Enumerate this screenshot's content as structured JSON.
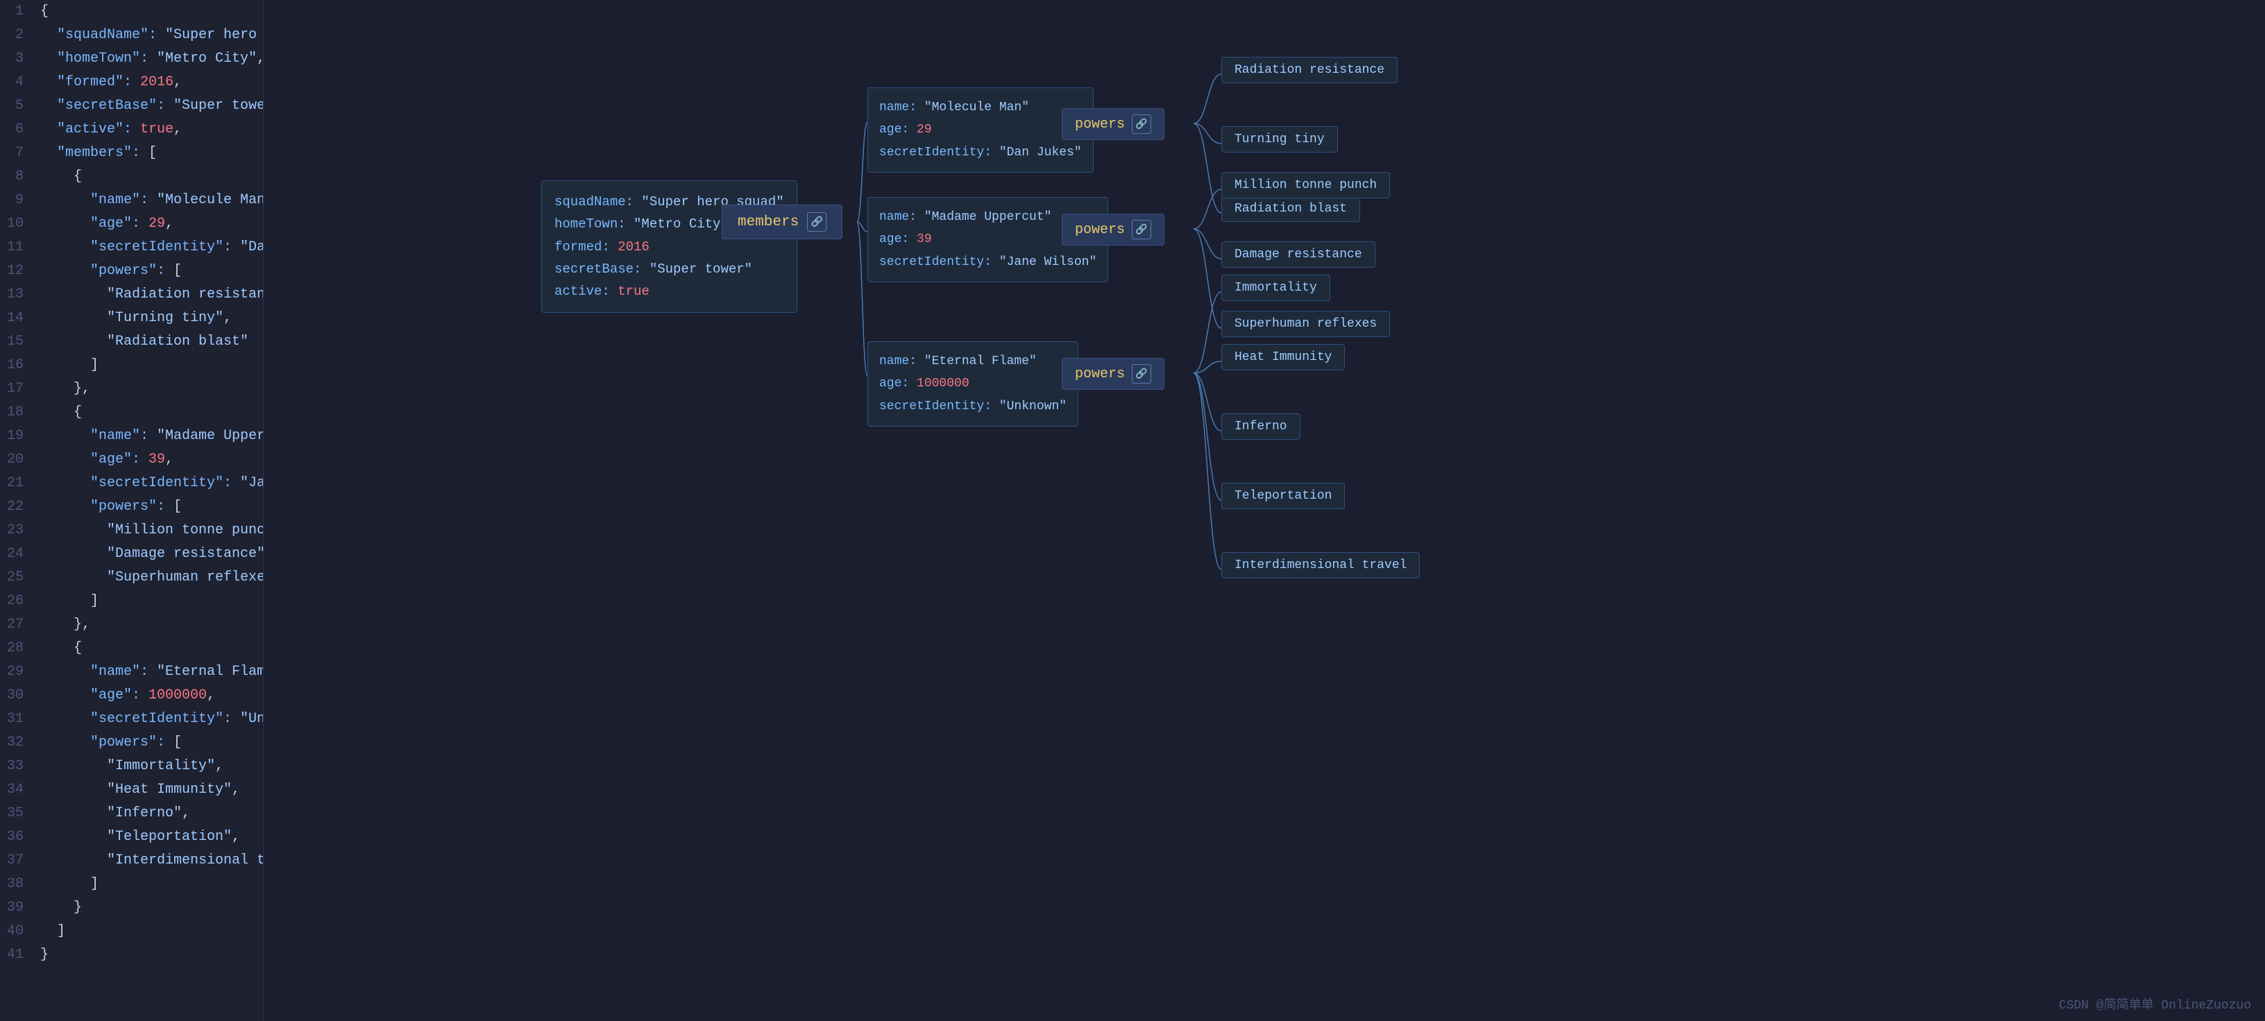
{
  "codeLines": [
    {
      "num": 1,
      "tokens": [
        {
          "t": "brace",
          "v": "{"
        }
      ]
    },
    {
      "num": 2,
      "tokens": [
        {
          "t": "key",
          "v": "  \"squadName\": "
        },
        {
          "t": "str",
          "v": "\"Super hero squad\""
        },
        {
          "t": "punct",
          "v": ","
        }
      ]
    },
    {
      "num": 3,
      "tokens": [
        {
          "t": "key",
          "v": "  \"homeTown\": "
        },
        {
          "t": "str",
          "v": "\"Metro City\""
        },
        {
          "t": "punct",
          "v": ","
        }
      ]
    },
    {
      "num": 4,
      "tokens": [
        {
          "t": "key",
          "v": "  \"formed\": "
        },
        {
          "t": "num",
          "v": "2016"
        },
        {
          "t": "punct",
          "v": ","
        }
      ]
    },
    {
      "num": 5,
      "tokens": [
        {
          "t": "key",
          "v": "  \"secretBase\": "
        },
        {
          "t": "str",
          "v": "\"Super tower\""
        },
        {
          "t": "punct",
          "v": ","
        }
      ]
    },
    {
      "num": 6,
      "tokens": [
        {
          "t": "key",
          "v": "  \"active\": "
        },
        {
          "t": "bool",
          "v": "true"
        },
        {
          "t": "punct",
          "v": ","
        }
      ]
    },
    {
      "num": 7,
      "tokens": [
        {
          "t": "key",
          "v": "  \"members\": "
        },
        {
          "t": "bracket",
          "v": "["
        }
      ]
    },
    {
      "num": 8,
      "tokens": [
        {
          "t": "brace",
          "v": "    {"
        }
      ]
    },
    {
      "num": 9,
      "tokens": [
        {
          "t": "key",
          "v": "      \"name\": "
        },
        {
          "t": "str",
          "v": "\"Molecule Man\""
        },
        {
          "t": "punct",
          "v": ","
        }
      ]
    },
    {
      "num": 10,
      "tokens": [
        {
          "t": "key",
          "v": "      \"age\": "
        },
        {
          "t": "num",
          "v": "29"
        },
        {
          "t": "punct",
          "v": ","
        }
      ]
    },
    {
      "num": 11,
      "tokens": [
        {
          "t": "key",
          "v": "      \"secretIdentity\": "
        },
        {
          "t": "str",
          "v": "\"Dan Jukes\""
        },
        {
          "t": "punct",
          "v": ","
        }
      ]
    },
    {
      "num": 12,
      "tokens": [
        {
          "t": "key",
          "v": "      \"powers\": "
        },
        {
          "t": "bracket",
          "v": "["
        }
      ]
    },
    {
      "num": 13,
      "tokens": [
        {
          "t": "str",
          "v": "        \"Radiation resistance\""
        },
        {
          "t": "punct",
          "v": ","
        }
      ]
    },
    {
      "num": 14,
      "tokens": [
        {
          "t": "str",
          "v": "        \"Turning tiny\""
        },
        {
          "t": "punct",
          "v": ","
        }
      ]
    },
    {
      "num": 15,
      "tokens": [
        {
          "t": "str",
          "v": "        \"Radiation blast\""
        }
      ]
    },
    {
      "num": 16,
      "tokens": [
        {
          "t": "bracket",
          "v": "      ]"
        }
      ]
    },
    {
      "num": 17,
      "tokens": [
        {
          "t": "brace",
          "v": "    },"
        }
      ]
    },
    {
      "num": 18,
      "tokens": [
        {
          "t": "brace",
          "v": "    {"
        }
      ]
    },
    {
      "num": 19,
      "tokens": [
        {
          "t": "key",
          "v": "      \"name\": "
        },
        {
          "t": "str",
          "v": "\"Madame Uppercut\""
        },
        {
          "t": "punct",
          "v": ","
        }
      ]
    },
    {
      "num": 20,
      "tokens": [
        {
          "t": "key",
          "v": "      \"age\": "
        },
        {
          "t": "num",
          "v": "39"
        },
        {
          "t": "punct",
          "v": ","
        }
      ]
    },
    {
      "num": 21,
      "tokens": [
        {
          "t": "key",
          "v": "      \"secretIdentity\": "
        },
        {
          "t": "str",
          "v": "\"Jane Wilson\""
        },
        {
          "t": "punct",
          "v": ","
        }
      ]
    },
    {
      "num": 22,
      "tokens": [
        {
          "t": "key",
          "v": "      \"powers\": "
        },
        {
          "t": "bracket",
          "v": "["
        }
      ]
    },
    {
      "num": 23,
      "tokens": [
        {
          "t": "str",
          "v": "        \"Million tonne punch\""
        },
        {
          "t": "punct",
          "v": ","
        }
      ]
    },
    {
      "num": 24,
      "tokens": [
        {
          "t": "str",
          "v": "        \"Damage resistance\""
        },
        {
          "t": "punct",
          "v": ","
        }
      ]
    },
    {
      "num": 25,
      "tokens": [
        {
          "t": "str",
          "v": "        \"Superhuman reflexes\""
        }
      ]
    },
    {
      "num": 26,
      "tokens": [
        {
          "t": "bracket",
          "v": "      ]"
        }
      ]
    },
    {
      "num": 27,
      "tokens": [
        {
          "t": "brace",
          "v": "    },"
        }
      ]
    },
    {
      "num": 28,
      "tokens": [
        {
          "t": "brace",
          "v": "    {"
        }
      ]
    },
    {
      "num": 29,
      "tokens": [
        {
          "t": "key",
          "v": "      \"name\": "
        },
        {
          "t": "str",
          "v": "\"Eternal Flame\""
        },
        {
          "t": "punct",
          "v": ","
        }
      ]
    },
    {
      "num": 30,
      "tokens": [
        {
          "t": "key",
          "v": "      \"age\": "
        },
        {
          "t": "num",
          "v": "1000000"
        },
        {
          "t": "punct",
          "v": ","
        }
      ]
    },
    {
      "num": 31,
      "tokens": [
        {
          "t": "key",
          "v": "      \"secretIdentity\": "
        },
        {
          "t": "str",
          "v": "\"Unknown\""
        },
        {
          "t": "punct",
          "v": ","
        }
      ]
    },
    {
      "num": 32,
      "tokens": [
        {
          "t": "key",
          "v": "      \"powers\": "
        },
        {
          "t": "bracket",
          "v": "["
        }
      ]
    },
    {
      "num": 33,
      "tokens": [
        {
          "t": "str",
          "v": "        \"Immortality\""
        },
        {
          "t": "punct",
          "v": ","
        }
      ]
    },
    {
      "num": 34,
      "tokens": [
        {
          "t": "str",
          "v": "        \"Heat Immunity\""
        },
        {
          "t": "punct",
          "v": ","
        }
      ]
    },
    {
      "num": 35,
      "tokens": [
        {
          "t": "str",
          "v": "        \"Inferno\""
        },
        {
          "t": "punct",
          "v": ","
        }
      ]
    },
    {
      "num": 36,
      "tokens": [
        {
          "t": "str",
          "v": "        \"Teleportation\""
        },
        {
          "t": "punct",
          "v": ","
        }
      ]
    },
    {
      "num": 37,
      "tokens": [
        {
          "t": "str",
          "v": "        \"Interdimensional travel\""
        }
      ]
    },
    {
      "num": 38,
      "tokens": [
        {
          "t": "bracket",
          "v": "      ]"
        }
      ]
    },
    {
      "num": 39,
      "tokens": [
        {
          "t": "brace",
          "v": "    }"
        }
      ]
    },
    {
      "num": 40,
      "tokens": [
        {
          "t": "bracket",
          "v": "  ]"
        }
      ]
    },
    {
      "num": 41,
      "tokens": [
        {
          "t": "brace",
          "v": "}"
        }
      ]
    }
  ],
  "rootNode": {
    "fields": [
      {
        "key": "squadName:",
        "value": "\"Super hero squad\"",
        "type": "str"
      },
      {
        "key": "homeTown:",
        "value": "\"Metro City\"",
        "type": "str"
      },
      {
        "key": "formed:",
        "value": "2016",
        "type": "num"
      },
      {
        "key": "secretBase:",
        "value": "\"Super tower\"",
        "type": "str"
      },
      {
        "key": "active:",
        "value": "true",
        "type": "bool"
      }
    ]
  },
  "membersBtn": "members",
  "members": [
    {
      "name": "\"Molecule Man\"",
      "age": "29",
      "secretIdentity": "\"Dan Jukes\"",
      "powers": [
        "Radiation resistance",
        "Turning tiny",
        "Radiation blast"
      ]
    },
    {
      "name": "\"Madame Uppercut\"",
      "age": "39",
      "secretIdentity": "\"Jane Wilson\"",
      "powers": [
        "Million tonne punch",
        "Damage resistance",
        "Superhuman reflexes"
      ]
    },
    {
      "name": "\"Eternal Flame\"",
      "age": "1000000",
      "secretIdentity": "\"Unknown\"",
      "powers": [
        "Immortality",
        "Heat Immunity",
        "Inferno",
        "Teleportation",
        "Interdimensional travel"
      ]
    }
  ],
  "powersLabel": "powers",
  "watermark": "CSDN @简简单单 OnlineZuozuo"
}
